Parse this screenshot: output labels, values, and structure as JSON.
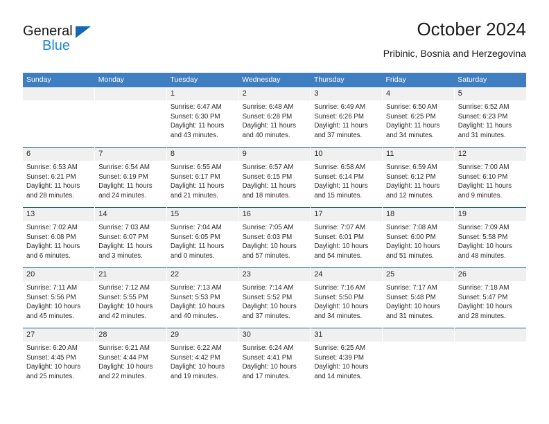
{
  "brand": {
    "name_top": "General",
    "name_bottom": "Blue",
    "accent_color": "#1268b3",
    "blue_text_color": "#1e87d6"
  },
  "header": {
    "title": "October 2024",
    "subtitle": "Pribinic, Bosnia and Herzegovina"
  },
  "theme": {
    "header_bg": "#3f7fc1",
    "daynum_bg": "#f0f0f0",
    "row_rule": "#1a5fa8"
  },
  "calendar": {
    "weekday_headers": [
      "Sunday",
      "Monday",
      "Tuesday",
      "Wednesday",
      "Thursday",
      "Friday",
      "Saturday"
    ],
    "weeks": [
      [
        {
          "day": "",
          "sunrise": "",
          "sunset": "",
          "daylight1": "",
          "daylight2": ""
        },
        {
          "day": "",
          "sunrise": "",
          "sunset": "",
          "daylight1": "",
          "daylight2": ""
        },
        {
          "day": "1",
          "sunrise": "Sunrise: 6:47 AM",
          "sunset": "Sunset: 6:30 PM",
          "daylight1": "Daylight: 11 hours",
          "daylight2": "and 43 minutes."
        },
        {
          "day": "2",
          "sunrise": "Sunrise: 6:48 AM",
          "sunset": "Sunset: 6:28 PM",
          "daylight1": "Daylight: 11 hours",
          "daylight2": "and 40 minutes."
        },
        {
          "day": "3",
          "sunrise": "Sunrise: 6:49 AM",
          "sunset": "Sunset: 6:26 PM",
          "daylight1": "Daylight: 11 hours",
          "daylight2": "and 37 minutes."
        },
        {
          "day": "4",
          "sunrise": "Sunrise: 6:50 AM",
          "sunset": "Sunset: 6:25 PM",
          "daylight1": "Daylight: 11 hours",
          "daylight2": "and 34 minutes."
        },
        {
          "day": "5",
          "sunrise": "Sunrise: 6:52 AM",
          "sunset": "Sunset: 6:23 PM",
          "daylight1": "Daylight: 11 hours",
          "daylight2": "and 31 minutes."
        }
      ],
      [
        {
          "day": "6",
          "sunrise": "Sunrise: 6:53 AM",
          "sunset": "Sunset: 6:21 PM",
          "daylight1": "Daylight: 11 hours",
          "daylight2": "and 28 minutes."
        },
        {
          "day": "7",
          "sunrise": "Sunrise: 6:54 AM",
          "sunset": "Sunset: 6:19 PM",
          "daylight1": "Daylight: 11 hours",
          "daylight2": "and 24 minutes."
        },
        {
          "day": "8",
          "sunrise": "Sunrise: 6:55 AM",
          "sunset": "Sunset: 6:17 PM",
          "daylight1": "Daylight: 11 hours",
          "daylight2": "and 21 minutes."
        },
        {
          "day": "9",
          "sunrise": "Sunrise: 6:57 AM",
          "sunset": "Sunset: 6:15 PM",
          "daylight1": "Daylight: 11 hours",
          "daylight2": "and 18 minutes."
        },
        {
          "day": "10",
          "sunrise": "Sunrise: 6:58 AM",
          "sunset": "Sunset: 6:14 PM",
          "daylight1": "Daylight: 11 hours",
          "daylight2": "and 15 minutes."
        },
        {
          "day": "11",
          "sunrise": "Sunrise: 6:59 AM",
          "sunset": "Sunset: 6:12 PM",
          "daylight1": "Daylight: 11 hours",
          "daylight2": "and 12 minutes."
        },
        {
          "day": "12",
          "sunrise": "Sunrise: 7:00 AM",
          "sunset": "Sunset: 6:10 PM",
          "daylight1": "Daylight: 11 hours",
          "daylight2": "and 9 minutes."
        }
      ],
      [
        {
          "day": "13",
          "sunrise": "Sunrise: 7:02 AM",
          "sunset": "Sunset: 6:08 PM",
          "daylight1": "Daylight: 11 hours",
          "daylight2": "and 6 minutes."
        },
        {
          "day": "14",
          "sunrise": "Sunrise: 7:03 AM",
          "sunset": "Sunset: 6:07 PM",
          "daylight1": "Daylight: 11 hours",
          "daylight2": "and 3 minutes."
        },
        {
          "day": "15",
          "sunrise": "Sunrise: 7:04 AM",
          "sunset": "Sunset: 6:05 PM",
          "daylight1": "Daylight: 11 hours",
          "daylight2": "and 0 minutes."
        },
        {
          "day": "16",
          "sunrise": "Sunrise: 7:05 AM",
          "sunset": "Sunset: 6:03 PM",
          "daylight1": "Daylight: 10 hours",
          "daylight2": "and 57 minutes."
        },
        {
          "day": "17",
          "sunrise": "Sunrise: 7:07 AM",
          "sunset": "Sunset: 6:01 PM",
          "daylight1": "Daylight: 10 hours",
          "daylight2": "and 54 minutes."
        },
        {
          "day": "18",
          "sunrise": "Sunrise: 7:08 AM",
          "sunset": "Sunset: 6:00 PM",
          "daylight1": "Daylight: 10 hours",
          "daylight2": "and 51 minutes."
        },
        {
          "day": "19",
          "sunrise": "Sunrise: 7:09 AM",
          "sunset": "Sunset: 5:58 PM",
          "daylight1": "Daylight: 10 hours",
          "daylight2": "and 48 minutes."
        }
      ],
      [
        {
          "day": "20",
          "sunrise": "Sunrise: 7:11 AM",
          "sunset": "Sunset: 5:56 PM",
          "daylight1": "Daylight: 10 hours",
          "daylight2": "and 45 minutes."
        },
        {
          "day": "21",
          "sunrise": "Sunrise: 7:12 AM",
          "sunset": "Sunset: 5:55 PM",
          "daylight1": "Daylight: 10 hours",
          "daylight2": "and 42 minutes."
        },
        {
          "day": "22",
          "sunrise": "Sunrise: 7:13 AM",
          "sunset": "Sunset: 5:53 PM",
          "daylight1": "Daylight: 10 hours",
          "daylight2": "and 40 minutes."
        },
        {
          "day": "23",
          "sunrise": "Sunrise: 7:14 AM",
          "sunset": "Sunset: 5:52 PM",
          "daylight1": "Daylight: 10 hours",
          "daylight2": "and 37 minutes."
        },
        {
          "day": "24",
          "sunrise": "Sunrise: 7:16 AM",
          "sunset": "Sunset: 5:50 PM",
          "daylight1": "Daylight: 10 hours",
          "daylight2": "and 34 minutes."
        },
        {
          "day": "25",
          "sunrise": "Sunrise: 7:17 AM",
          "sunset": "Sunset: 5:48 PM",
          "daylight1": "Daylight: 10 hours",
          "daylight2": "and 31 minutes."
        },
        {
          "day": "26",
          "sunrise": "Sunrise: 7:18 AM",
          "sunset": "Sunset: 5:47 PM",
          "daylight1": "Daylight: 10 hours",
          "daylight2": "and 28 minutes."
        }
      ],
      [
        {
          "day": "27",
          "sunrise": "Sunrise: 6:20 AM",
          "sunset": "Sunset: 4:45 PM",
          "daylight1": "Daylight: 10 hours",
          "daylight2": "and 25 minutes."
        },
        {
          "day": "28",
          "sunrise": "Sunrise: 6:21 AM",
          "sunset": "Sunset: 4:44 PM",
          "daylight1": "Daylight: 10 hours",
          "daylight2": "and 22 minutes."
        },
        {
          "day": "29",
          "sunrise": "Sunrise: 6:22 AM",
          "sunset": "Sunset: 4:42 PM",
          "daylight1": "Daylight: 10 hours",
          "daylight2": "and 19 minutes."
        },
        {
          "day": "30",
          "sunrise": "Sunrise: 6:24 AM",
          "sunset": "Sunset: 4:41 PM",
          "daylight1": "Daylight: 10 hours",
          "daylight2": "and 17 minutes."
        },
        {
          "day": "31",
          "sunrise": "Sunrise: 6:25 AM",
          "sunset": "Sunset: 4:39 PM",
          "daylight1": "Daylight: 10 hours",
          "daylight2": "and 14 minutes."
        },
        {
          "day": "",
          "sunrise": "",
          "sunset": "",
          "daylight1": "",
          "daylight2": ""
        },
        {
          "day": "",
          "sunrise": "",
          "sunset": "",
          "daylight1": "",
          "daylight2": ""
        }
      ]
    ]
  }
}
